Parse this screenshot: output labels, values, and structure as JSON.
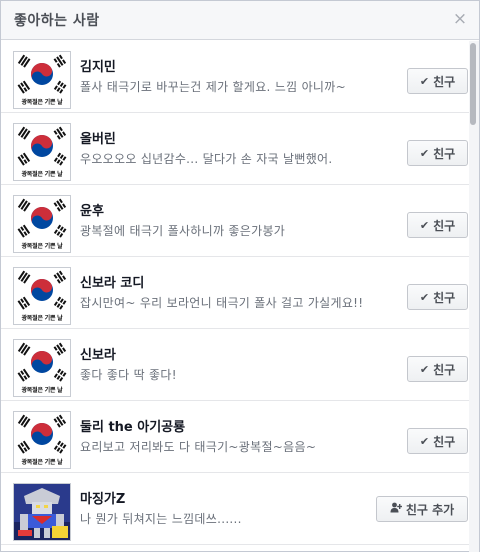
{
  "dialog": {
    "title": "좋아하는 사람",
    "close_icon": "close-icon",
    "close_glyph": "×"
  },
  "flag_caption": "광복절은 기쁜 날",
  "people": [
    {
      "name": "김지민",
      "comment": "폴사 태극기로 바꾸는건 제가 할게요. 느낌 아니까~",
      "button_label": "친구",
      "button_icon": "check-icon",
      "avatar": "taegukgi-flag"
    },
    {
      "name": "올버린",
      "comment": "우오오오오 십년감수... 달다가 손 자국 날뻔했어.",
      "button_label": "친구",
      "button_icon": "check-icon",
      "avatar": "taegukgi-flag"
    },
    {
      "name": "윤후",
      "comment": "광복절에 태극기 폴사하니까 좋은가봉가",
      "button_label": "친구",
      "button_icon": "check-icon",
      "avatar": "taegukgi-flag"
    },
    {
      "name": "신보라 코디",
      "comment": "잡시만여~ 우리 보라언니 태극기 폴사 걸고 가실게요!!",
      "button_label": "친구",
      "button_icon": "check-icon",
      "avatar": "taegukgi-flag"
    },
    {
      "name": "신보라",
      "comment": "좋다 좋다 딱 좋다!",
      "button_label": "친구",
      "button_icon": "check-icon",
      "avatar": "taegukgi-flag"
    },
    {
      "name": "둘리 the 아기공룡",
      "comment": "요리보고 저리봐도 다 태극기~광복절~음음~",
      "button_label": "친구",
      "button_icon": "check-icon",
      "avatar": "taegukgi-flag"
    },
    {
      "name": "마징가Z",
      "comment": "나 뭔가 뒤쳐지는 느낌데쓰......",
      "button_label": "친구 추가",
      "button_icon": "add-friend-icon",
      "avatar": "robot-picture"
    }
  ],
  "colors": {
    "flag_red": "#cd2e3a",
    "flag_blue": "#0047a0",
    "button_text": "#4b4f56"
  }
}
